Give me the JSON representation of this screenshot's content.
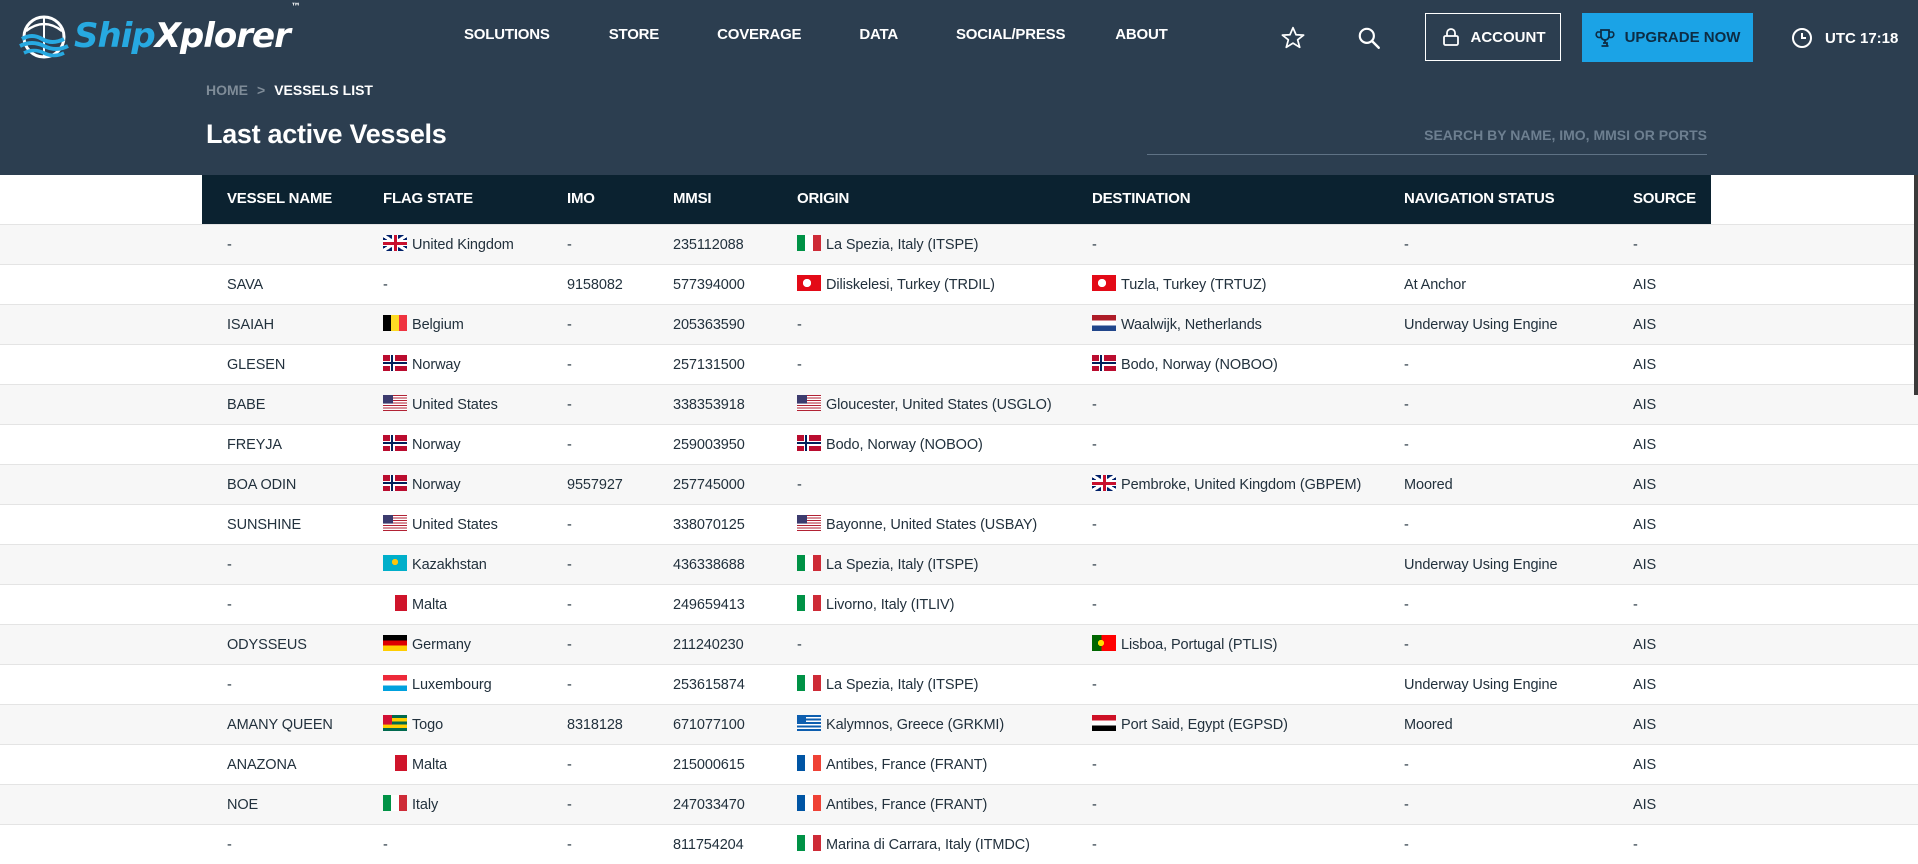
{
  "brand": {
    "part1": "Ship",
    "part2": "Xplorer",
    "tm": "™"
  },
  "nav": [
    "SOLUTIONS",
    "STORE",
    "COVERAGE",
    "DATA",
    "SOCIAL/PRESS",
    "ABOUT"
  ],
  "header": {
    "account_label": "ACCOUNT",
    "upgrade_label": "UPGRADE NOW",
    "time": "UTC 17:18"
  },
  "breadcrumb": {
    "home": "HOME",
    "separator": ">",
    "current": "VESSELS LIST"
  },
  "page_title": "Last active Vessels",
  "search": {
    "placeholder": "SEARCH BY NAME, IMO, MMSI OR PORTS"
  },
  "colors": {
    "header_bg": "#2c3e50",
    "table_header_bg": "#0b2230",
    "accent": "#1ba3e6",
    "brand_blue": "#27a9e1"
  },
  "table": {
    "columns": [
      "VESSEL NAME",
      "FLAG STATE",
      "IMO",
      "MMSI",
      "ORIGIN",
      "DESTINATION",
      "NAVIGATION STATUS",
      "SOURCE"
    ],
    "rows": [
      {
        "name": "-",
        "flag_icon": "uk",
        "flag": "United Kingdom",
        "imo": "-",
        "mmsi": "235112088",
        "origin_icon": "it",
        "origin": "La Spezia, Italy (ITSPE)",
        "dest_icon": "",
        "dest": "-",
        "status": "-",
        "source": "-"
      },
      {
        "name": "SAVA",
        "flag_icon": "",
        "flag": "-",
        "imo": "9158082",
        "mmsi": "577394000",
        "origin_icon": "tr",
        "origin": "Diliskelesi, Turkey (TRDIL)",
        "dest_icon": "tr",
        "dest": "Tuzla, Turkey (TRTUZ)",
        "status": "At Anchor",
        "source": "AIS"
      },
      {
        "name": "ISAIAH",
        "flag_icon": "be",
        "flag": "Belgium",
        "imo": "-",
        "mmsi": "205363590",
        "origin_icon": "",
        "origin": "-",
        "dest_icon": "nl",
        "dest": "Waalwijk, Netherlands",
        "status": "Underway Using Engine",
        "source": "AIS"
      },
      {
        "name": "GLESEN",
        "flag_icon": "no",
        "flag": "Norway",
        "imo": "-",
        "mmsi": "257131500",
        "origin_icon": "",
        "origin": "-",
        "dest_icon": "no",
        "dest": "Bodo, Norway (NOBOO)",
        "status": "-",
        "source": "AIS"
      },
      {
        "name": "BABE",
        "flag_icon": "us",
        "flag": "United States",
        "imo": "-",
        "mmsi": "338353918",
        "origin_icon": "us",
        "origin": "Gloucester, United States (USGLO)",
        "dest_icon": "",
        "dest": "-",
        "status": "-",
        "source": "AIS"
      },
      {
        "name": "FREYJA",
        "flag_icon": "no",
        "flag": "Norway",
        "imo": "-",
        "mmsi": "259003950",
        "origin_icon": "no",
        "origin": "Bodo, Norway (NOBOO)",
        "dest_icon": "",
        "dest": "-",
        "status": "-",
        "source": "AIS"
      },
      {
        "name": "BOA ODIN",
        "flag_icon": "no",
        "flag": "Norway",
        "imo": "9557927",
        "mmsi": "257745000",
        "origin_icon": "",
        "origin": "-",
        "dest_icon": "uk",
        "dest": "Pembroke, United Kingdom (GBPEM)",
        "status": "Moored",
        "source": "AIS"
      },
      {
        "name": "SUNSHINE",
        "flag_icon": "us",
        "flag": "United States",
        "imo": "-",
        "mmsi": "338070125",
        "origin_icon": "us",
        "origin": "Bayonne, United States (USBAY)",
        "dest_icon": "",
        "dest": "-",
        "status": "-",
        "source": "AIS"
      },
      {
        "name": "-",
        "flag_icon": "kz",
        "flag": "Kazakhstan",
        "imo": "-",
        "mmsi": "436338688",
        "origin_icon": "it",
        "origin": "La Spezia, Italy (ITSPE)",
        "dest_icon": "",
        "dest": "-",
        "status": "Underway Using Engine",
        "source": "AIS"
      },
      {
        "name": "-",
        "flag_icon": "mt",
        "flag": "Malta",
        "imo": "-",
        "mmsi": "249659413",
        "origin_icon": "it",
        "origin": "Livorno, Italy (ITLIV)",
        "dest_icon": "",
        "dest": "-",
        "status": "-",
        "source": "-"
      },
      {
        "name": "ODYSSEUS",
        "flag_icon": "de",
        "flag": "Germany",
        "imo": "-",
        "mmsi": "211240230",
        "origin_icon": "",
        "origin": "-",
        "dest_icon": "pt",
        "dest": "Lisboa, Portugal (PTLIS)",
        "status": "-",
        "source": "AIS"
      },
      {
        "name": "-",
        "flag_icon": "lu",
        "flag": "Luxembourg",
        "imo": "-",
        "mmsi": "253615874",
        "origin_icon": "it",
        "origin": "La Spezia, Italy (ITSPE)",
        "dest_icon": "",
        "dest": "-",
        "status": "Underway Using Engine",
        "source": "AIS"
      },
      {
        "name": "AMANY QUEEN",
        "flag_icon": "tg",
        "flag": "Togo",
        "imo": "8318128",
        "mmsi": "671077100",
        "origin_icon": "gr",
        "origin": "Kalymnos, Greece (GRKMI)",
        "dest_icon": "eg",
        "dest": "Port Said, Egypt (EGPSD)",
        "status": "Moored",
        "source": "AIS"
      },
      {
        "name": "ANAZONA",
        "flag_icon": "mt",
        "flag": "Malta",
        "imo": "-",
        "mmsi": "215000615",
        "origin_icon": "fr",
        "origin": "Antibes, France (FRANT)",
        "dest_icon": "",
        "dest": "-",
        "status": "-",
        "source": "AIS"
      },
      {
        "name": "NOE",
        "flag_icon": "it",
        "flag": "Italy",
        "imo": "-",
        "mmsi": "247033470",
        "origin_icon": "fr",
        "origin": "Antibes, France (FRANT)",
        "dest_icon": "",
        "dest": "-",
        "status": "-",
        "source": "AIS"
      },
      {
        "name": "-",
        "flag_icon": "",
        "flag": "-",
        "imo": "-",
        "mmsi": "811754204",
        "origin_icon": "it",
        "origin": "Marina di Carrara, Italy (ITMDC)",
        "dest_icon": "",
        "dest": "-",
        "status": "-",
        "source": "-"
      }
    ]
  }
}
